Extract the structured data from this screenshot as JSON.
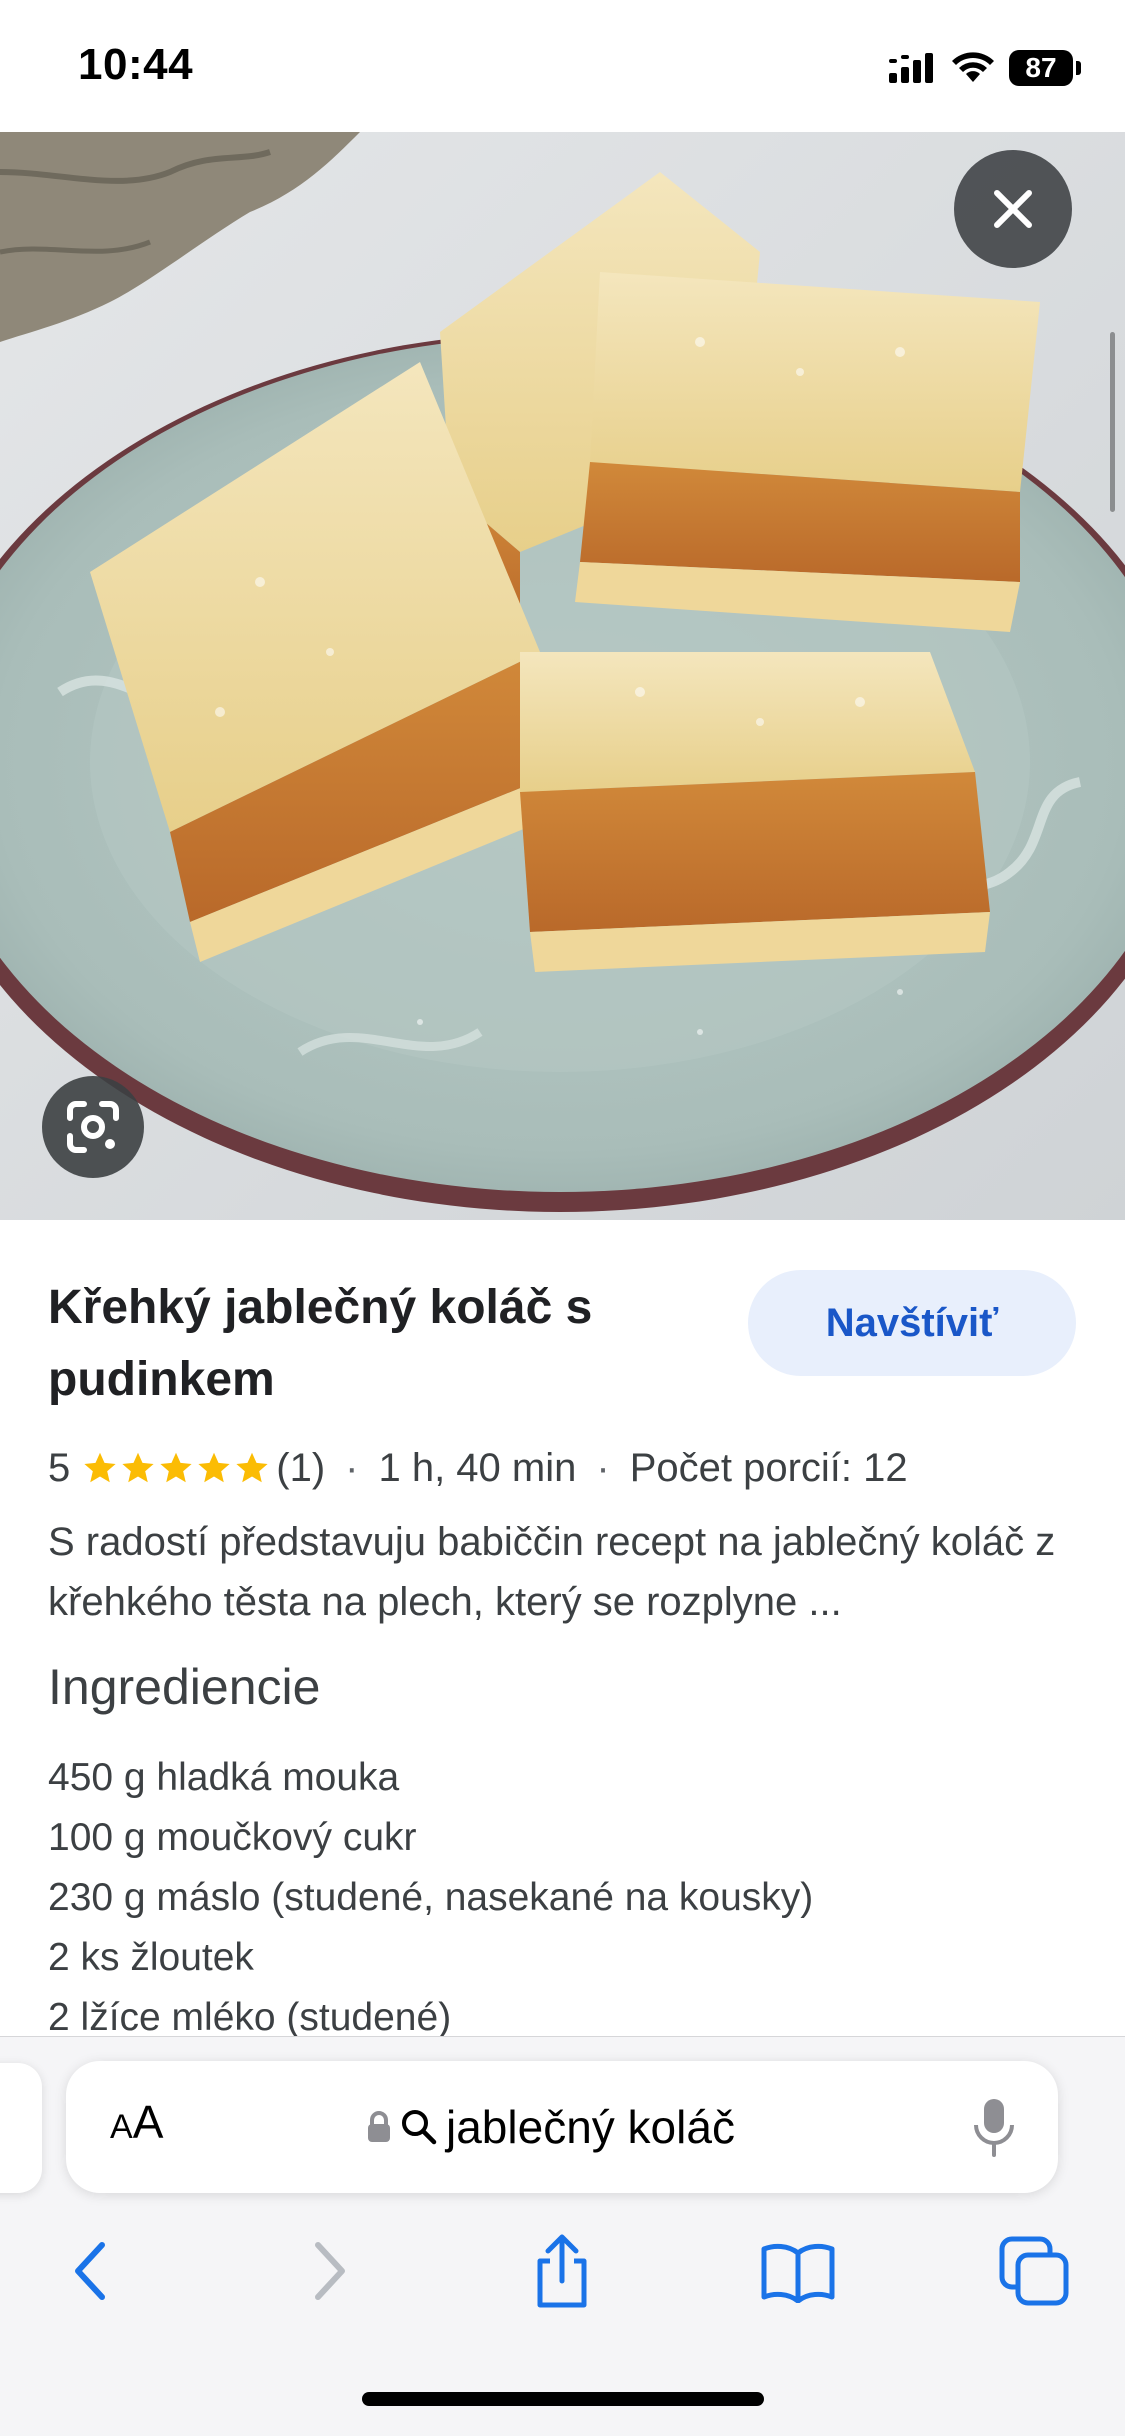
{
  "status_bar": {
    "time": "10:44",
    "battery": "87",
    "signal_icon": "cellular-signal-icon",
    "wifi_icon": "wifi-icon"
  },
  "hero": {
    "close_icon": "close-icon",
    "lens_icon": "google-lens-icon"
  },
  "recipe": {
    "title": "Křehký jablečný koláč s pudinkem",
    "visit_label": "Navštíviť",
    "rating": "5",
    "stars_filled": 5,
    "rating_count": "(1)",
    "separator": "·",
    "time": "1 h, 40 min",
    "servings": "Počet porcií: 12",
    "description": "S radostí představuju babiččin recept na jablečný koláč z křehkého těsta na plech, který se rozplyne ...",
    "ingredients_heading": "Ingrediencie",
    "ingredients": [
      "450 g hladká mouka",
      "100 g moučkový cukr",
      "230 g máslo (studené, nasekané na kousky)",
      "2 ks žloutek",
      "2 lžíce mléko (studené)"
    ]
  },
  "browser": {
    "aa_small": "A",
    "aa_big": "A",
    "url": "jablečný koláč",
    "lock_icon": "lock-icon",
    "search_icon": "search-icon",
    "mic_icon": "microphone-icon",
    "toolbar": [
      "back-icon",
      "forward-icon",
      "share-icon",
      "bookmarks-icon",
      "tabs-icon"
    ]
  },
  "colors": {
    "accent": "#1a57c8",
    "visit_bg": "#e8effc",
    "star": "#fbbc04",
    "toolbar_icon": "#1a73e8",
    "disabled_icon": "#b8bcc2"
  }
}
